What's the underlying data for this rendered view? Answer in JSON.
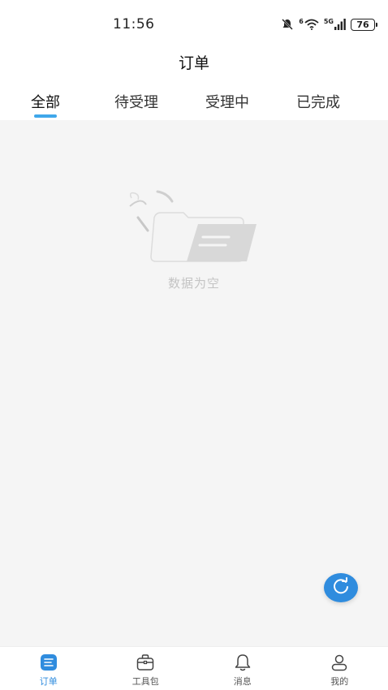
{
  "status_bar": {
    "time": "11:56",
    "network_label": "5G",
    "wifi_label": "6",
    "battery": "76",
    "icons": [
      "mute-icon",
      "wifi-icon",
      "signal-icon",
      "battery-icon"
    ]
  },
  "header": {
    "title": "订单"
  },
  "tabs": [
    {
      "label": "全部",
      "active": true
    },
    {
      "label": "待受理",
      "active": false
    },
    {
      "label": "受理中",
      "active": false
    },
    {
      "label": "已完成",
      "active": false
    }
  ],
  "empty_state": {
    "text": "数据为空",
    "icon": "empty-folder-icon"
  },
  "fab": {
    "icon": "refresh-icon"
  },
  "bottom_nav": [
    {
      "label": "订单",
      "icon": "order-list-icon",
      "active": true
    },
    {
      "label": "工具包",
      "icon": "toolbox-icon",
      "active": false
    },
    {
      "label": "消息",
      "icon": "bell-icon",
      "active": false
    },
    {
      "label": "我的",
      "icon": "user-icon",
      "active": false
    }
  ],
  "colors": {
    "accent": "#2f8cde",
    "tab_underline": "#3fa7ea",
    "background": "#f5f5f5",
    "empty_text": "#c4c4c4"
  }
}
